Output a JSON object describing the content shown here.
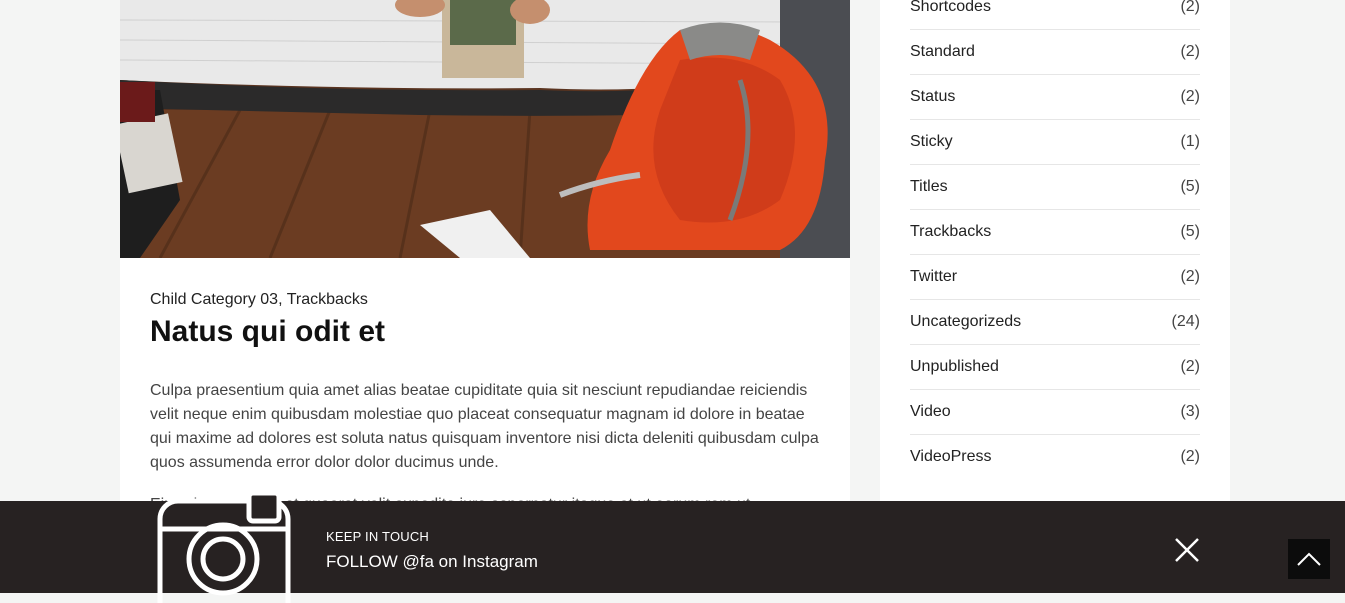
{
  "post": {
    "categories": [
      "Child Category 03",
      "Trackbacks"
    ],
    "separator": ", ",
    "title": "Natus qui odit et",
    "excerpt": "Culpa praesentium quia amet alias beatae cupiditate quia sit nesciunt repudiandae reiciendis velit neque enim quibusdam molestiae quo placeat consequatur magnam id dolore in beatae qui maxime ad dolores est soluta natus quisquam inventore nisi dicta deleniti quibusdam culpa quos assumenda error dolor dolor ducimus unde.",
    "excerpt2": "Eius cleana test ut at quaerat velit expedita iure aspernatur itaque et ut earum rem ut"
  },
  "sidebar": {
    "categories": [
      {
        "name": "Shortcodes",
        "count": "(2)"
      },
      {
        "name": "Standard",
        "count": "(2)"
      },
      {
        "name": "Status",
        "count": "(2)"
      },
      {
        "name": "Sticky",
        "count": "(1)"
      },
      {
        "name": "Titles",
        "count": "(5)"
      },
      {
        "name": "Trackbacks",
        "count": "(5)"
      },
      {
        "name": "Twitter",
        "count": "(2)"
      },
      {
        "name": "Uncategorizeds",
        "count": "(24)"
      },
      {
        "name": "Unpublished",
        "count": "(2)"
      },
      {
        "name": "Video",
        "count": "(3)"
      },
      {
        "name": "VideoPress",
        "count": "(2)"
      }
    ]
  },
  "instagram_bar": {
    "kicker": "KEEP IN TOUCH",
    "follow_text": "FOLLOW @fa on Instagram",
    "icon": "instagram-camera-icon",
    "close_icon": "close-icon"
  },
  "back_to_top": {
    "icon": "chevron-up-icon"
  },
  "colors": {
    "bar_bg": "#272222",
    "accent_orange": "#e2481d"
  }
}
